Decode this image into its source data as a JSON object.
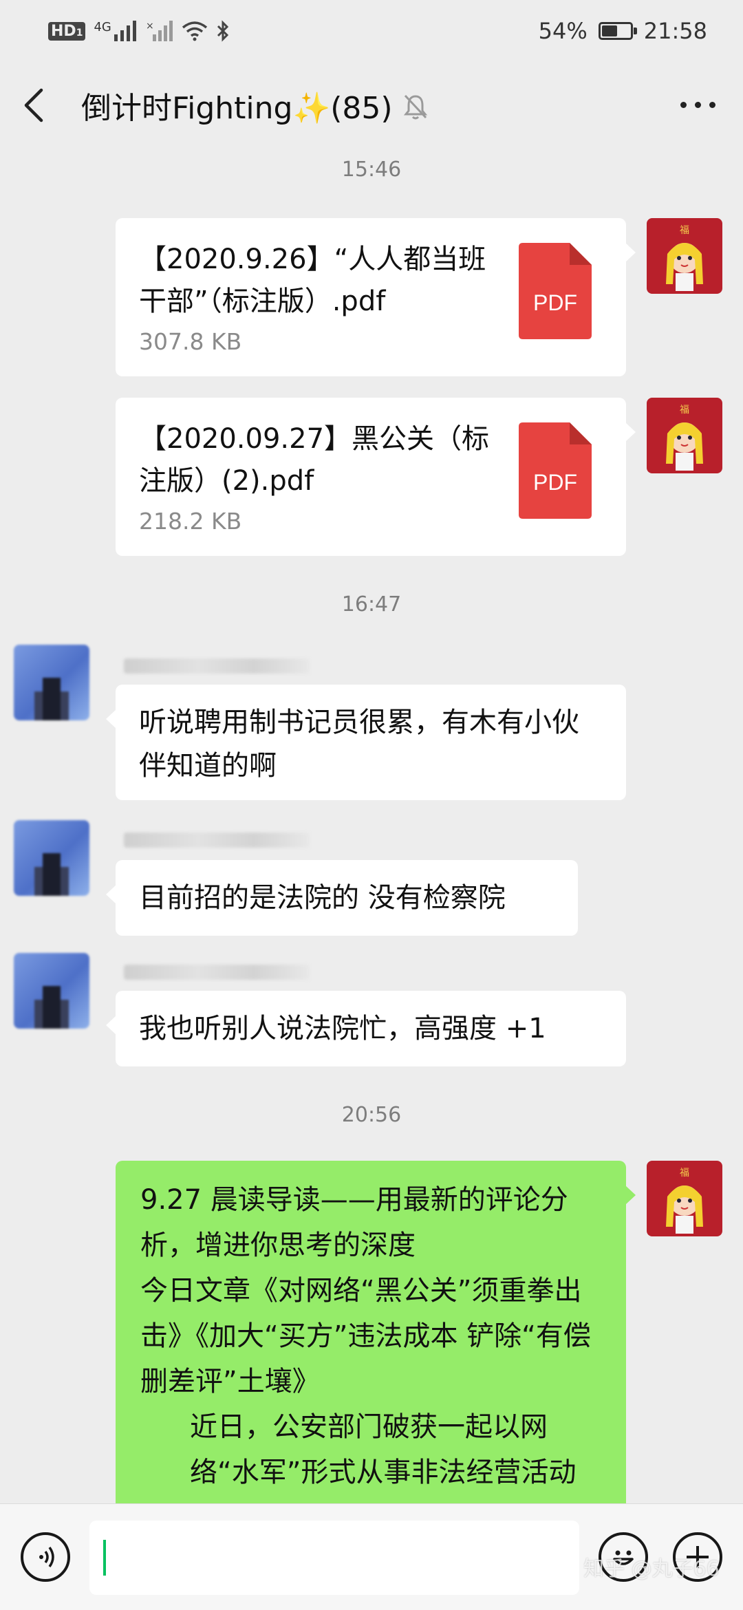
{
  "status_bar": {
    "hd": "HD",
    "hd_sub": "1",
    "network": "4G",
    "battery_percent": "54%",
    "battery_level": 0.54,
    "time": "21:58"
  },
  "nav": {
    "title": "倒计时Fighting✨(85)"
  },
  "messages": [
    {
      "type": "time",
      "text": "15:46"
    },
    {
      "type": "file",
      "sender": "me",
      "name": "【2020.9.26】“人人都当班干部”（标注版）.pdf",
      "size": "307.8 KB",
      "icon": "PDF"
    },
    {
      "type": "file",
      "sender": "me",
      "name": "【2020.09.27】黑公关（标注版）(2).pdf",
      "size": "218.2 KB",
      "icon": "PDF"
    },
    {
      "type": "time",
      "text": "16:47"
    },
    {
      "type": "text",
      "sender": "other",
      "text": "听说聘用制书记员很累，有木有小伙伴知道的啊"
    },
    {
      "type": "text",
      "sender": "other",
      "text": "目前招的是法院的 没有检察院"
    },
    {
      "type": "text",
      "sender": "other",
      "text": "我也听别人说法院忙，高强度 +1"
    },
    {
      "type": "time",
      "text": "20:56"
    },
    {
      "type": "text",
      "sender": "me",
      "lines": [
        "9.27 晨读导读——用最新的评论分析，增进你思考的深度",
        "今日文章《对网络“黑公关”须重拳出击》《加大“买方”违法成本 铲除“有偿删差评”土壤》",
        "近日，公安部门破获一起以网络“水军”形式从事非法经营活动"
      ]
    }
  ],
  "watermark": "知乎 @丸子66",
  "colors": {
    "background": "#ededed",
    "bubble_white": "#ffffff",
    "bubble_green": "#95ec69",
    "pdf_red": "#e64340",
    "caret_green": "#07c160"
  },
  "icons": [
    "back-arrow-icon",
    "mute-bell-icon",
    "more-dots-icon",
    "pdf-file-icon",
    "voice-icon",
    "emoji-icon",
    "plus-icon"
  ]
}
